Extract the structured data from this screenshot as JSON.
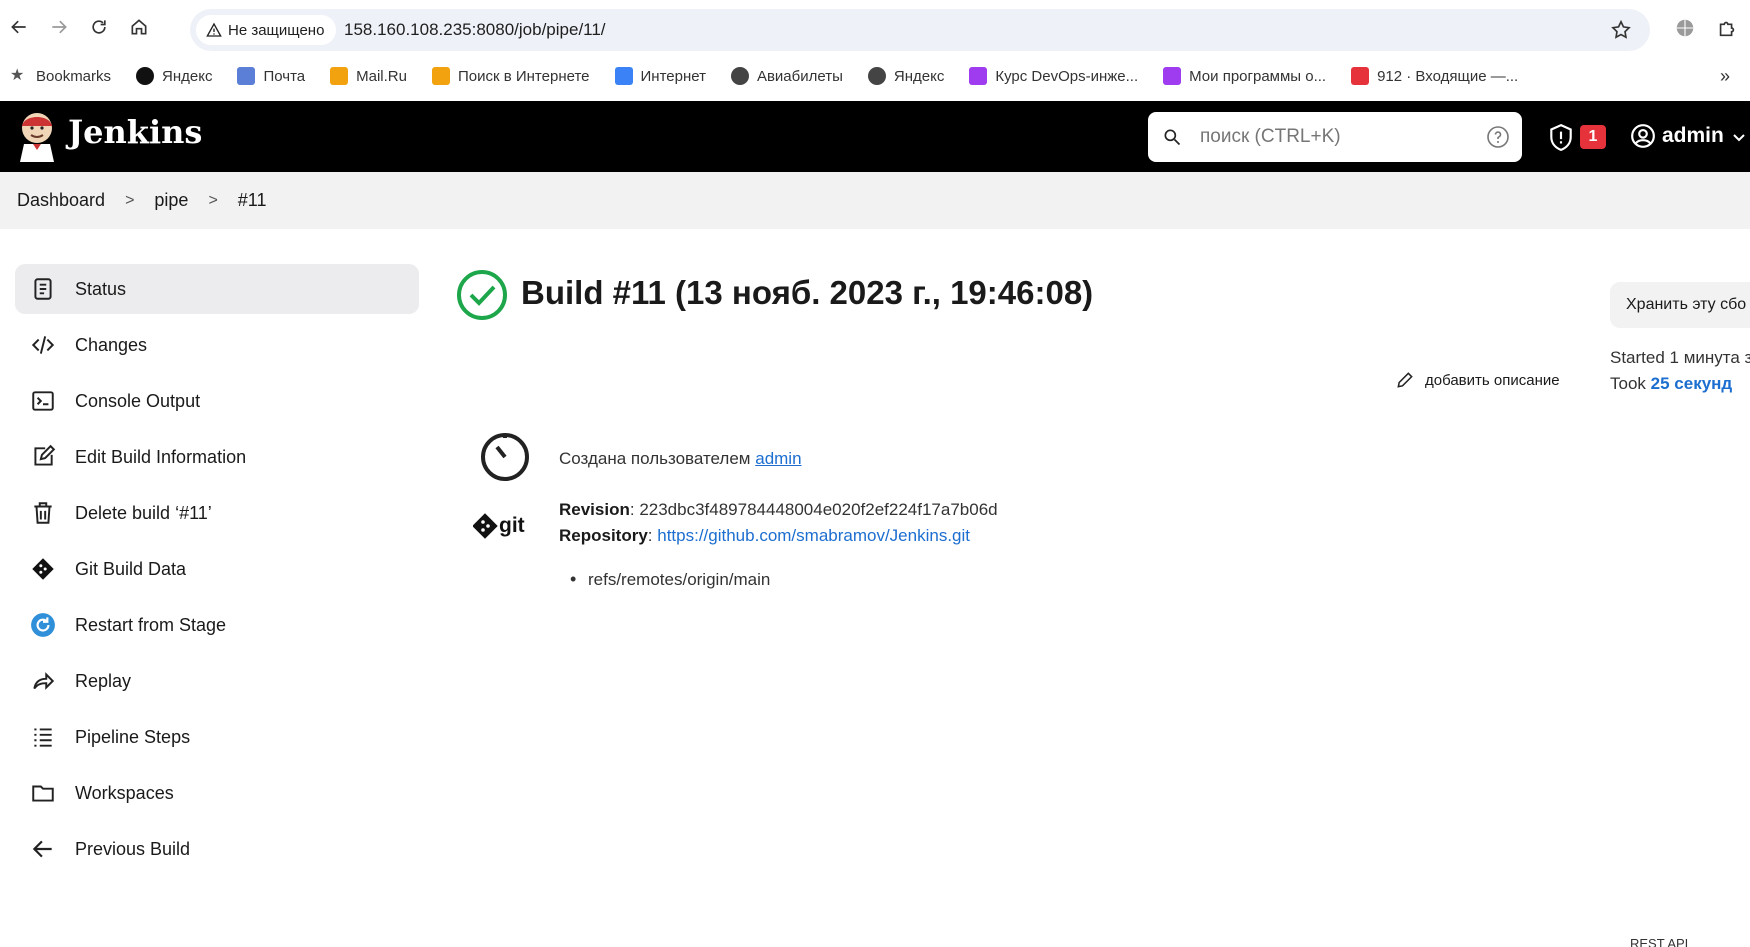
{
  "browser": {
    "security_label": "Не защищено",
    "url": "158.160.108.235:8080/job/pipe/11/",
    "bookmarks": [
      {
        "label": "Bookmarks",
        "icon": "star-icon",
        "color": "#555555"
      },
      {
        "label": "Яндекс",
        "icon": "yandex-icon",
        "color": "#111111"
      },
      {
        "label": "Почта",
        "icon": "mail-icon",
        "color": "#5b7fd6"
      },
      {
        "label": "Mail.Ru",
        "icon": "mailru-icon",
        "color": "#f2a20f"
      },
      {
        "label": "Поиск в Интернете",
        "icon": "search-web-icon",
        "color": "#f2a20f"
      },
      {
        "label": "Интернет",
        "icon": "browser-icon",
        "color": "#3b82f6"
      },
      {
        "label": "Авиабилеты",
        "icon": "globe-icon",
        "color": "#444444"
      },
      {
        "label": "Яндекс",
        "icon": "globe-icon",
        "color": "#444444"
      },
      {
        "label": "Курс DevOps-инже...",
        "icon": "grid-icon",
        "color": "#a03cf0"
      },
      {
        "label": "Мои программы о...",
        "icon": "grid-icon",
        "color": "#a03cf0"
      },
      {
        "label": "912 · Входящие —...",
        "icon": "gmail-icon",
        "color": "#e5323b"
      }
    ],
    "bookmarks_more": "»"
  },
  "header": {
    "title": "Jenkins",
    "search_placeholder": "поиск (CTRL+K)",
    "security_count": "1",
    "user": "admin"
  },
  "breadcrumb": [
    "Dashboard",
    "pipe",
    "#11"
  ],
  "tasks": [
    {
      "label": "Status",
      "icon": "status-icon",
      "active": true
    },
    {
      "label": "Changes",
      "icon": "code-icon"
    },
    {
      "label": "Console Output",
      "icon": "terminal-icon"
    },
    {
      "label": "Edit Build Information",
      "icon": "edit-icon"
    },
    {
      "label": "Delete build ‘#11’",
      "icon": "trash-icon"
    },
    {
      "label": "Git Build Data",
      "icon": "git-icon"
    },
    {
      "label": "Restart from Stage",
      "icon": "restart-icon"
    },
    {
      "label": "Replay",
      "icon": "replay-icon"
    },
    {
      "label": "Pipeline Steps",
      "icon": "steps-icon"
    },
    {
      "label": "Workspaces",
      "icon": "folder-icon"
    },
    {
      "label": "Previous Build",
      "icon": "arrow-left-icon"
    }
  ],
  "build": {
    "title": "Build #11 (13 нояб. 2023 г., 19:46:08)",
    "status_color": "#1ea64b",
    "keep_label": "Хранить эту сбо",
    "started": "Started 1 минута з",
    "took_label": "Took",
    "took_value": "25 секунд",
    "add_description": "добавить описание",
    "created_by_label": "Создана пользователем",
    "created_by_user": "admin",
    "revision_label": "Revision",
    "revision_value": "223dbc3f489784448004e020f2ef224f17a7b06d",
    "repository_label": "Repository",
    "repository_value": "https://github.com/smabramov/Jenkins.git",
    "refs": [
      "refs/remotes/origin/main"
    ]
  },
  "footer": {
    "rest_api": "REST API"
  },
  "colors": {
    "link": "#1c6ed0",
    "accent": "#1ea64b",
    "badge": "#e5323b"
  }
}
